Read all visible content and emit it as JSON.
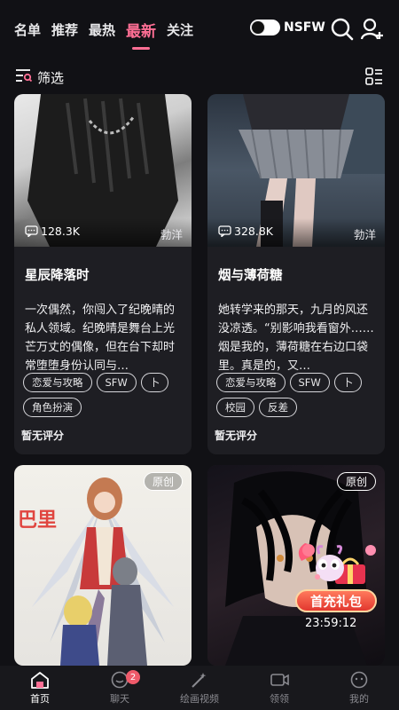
{
  "topnav": {
    "tabs": [
      {
        "label": "名单"
      },
      {
        "label": "推荐"
      },
      {
        "label": "最热"
      },
      {
        "label": "最新"
      },
      {
        "label": "关注"
      }
    ],
    "active_tab": "最新",
    "nsfw_label": "NSFW",
    "nsfw_enabled": false
  },
  "filter": {
    "label": "筛选"
  },
  "cards": [
    {
      "comments": "128.3K",
      "author": "勃洋",
      "title": "星辰降落时",
      "description": "一次偶然，你闯入了纪晚晴的私人领域。纪晚晴是舞台上光芒万丈的偶像，但在台下却时常堕堕身份认同与…",
      "tags": [
        "恋爱与攻略",
        "SFW",
        "卜",
        "角色扮演"
      ],
      "rating": "暂无评分"
    },
    {
      "comments": "328.8K",
      "author": "勃洋",
      "title": "烟与薄荷糖",
      "description": "她转学来的那天，九月的风还没凉透。“别影响我看窗外……烟是我的，薄荷糖在右边口袋里。真是的，又…",
      "tags": [
        "恋爱与攻略",
        "SFW",
        "卜",
        "校园",
        "反差"
      ],
      "rating": "暂无评分"
    },
    {
      "badge": "原创",
      "image_text": "巴里"
    },
    {
      "badge": "原创"
    }
  ],
  "promo": {
    "label": "首充礼包",
    "timer": "23:59:12"
  },
  "bottomnav": [
    {
      "label": "首页",
      "active": true
    },
    {
      "label": "聊天",
      "badge": "2"
    },
    {
      "label": "绘画视频"
    },
    {
      "label": "领领"
    },
    {
      "label": "我的"
    }
  ],
  "colors": {
    "accent": "#ff6f95",
    "background": "#111115",
    "card": "#1e1e23",
    "notif": "#ef5a6a"
  }
}
